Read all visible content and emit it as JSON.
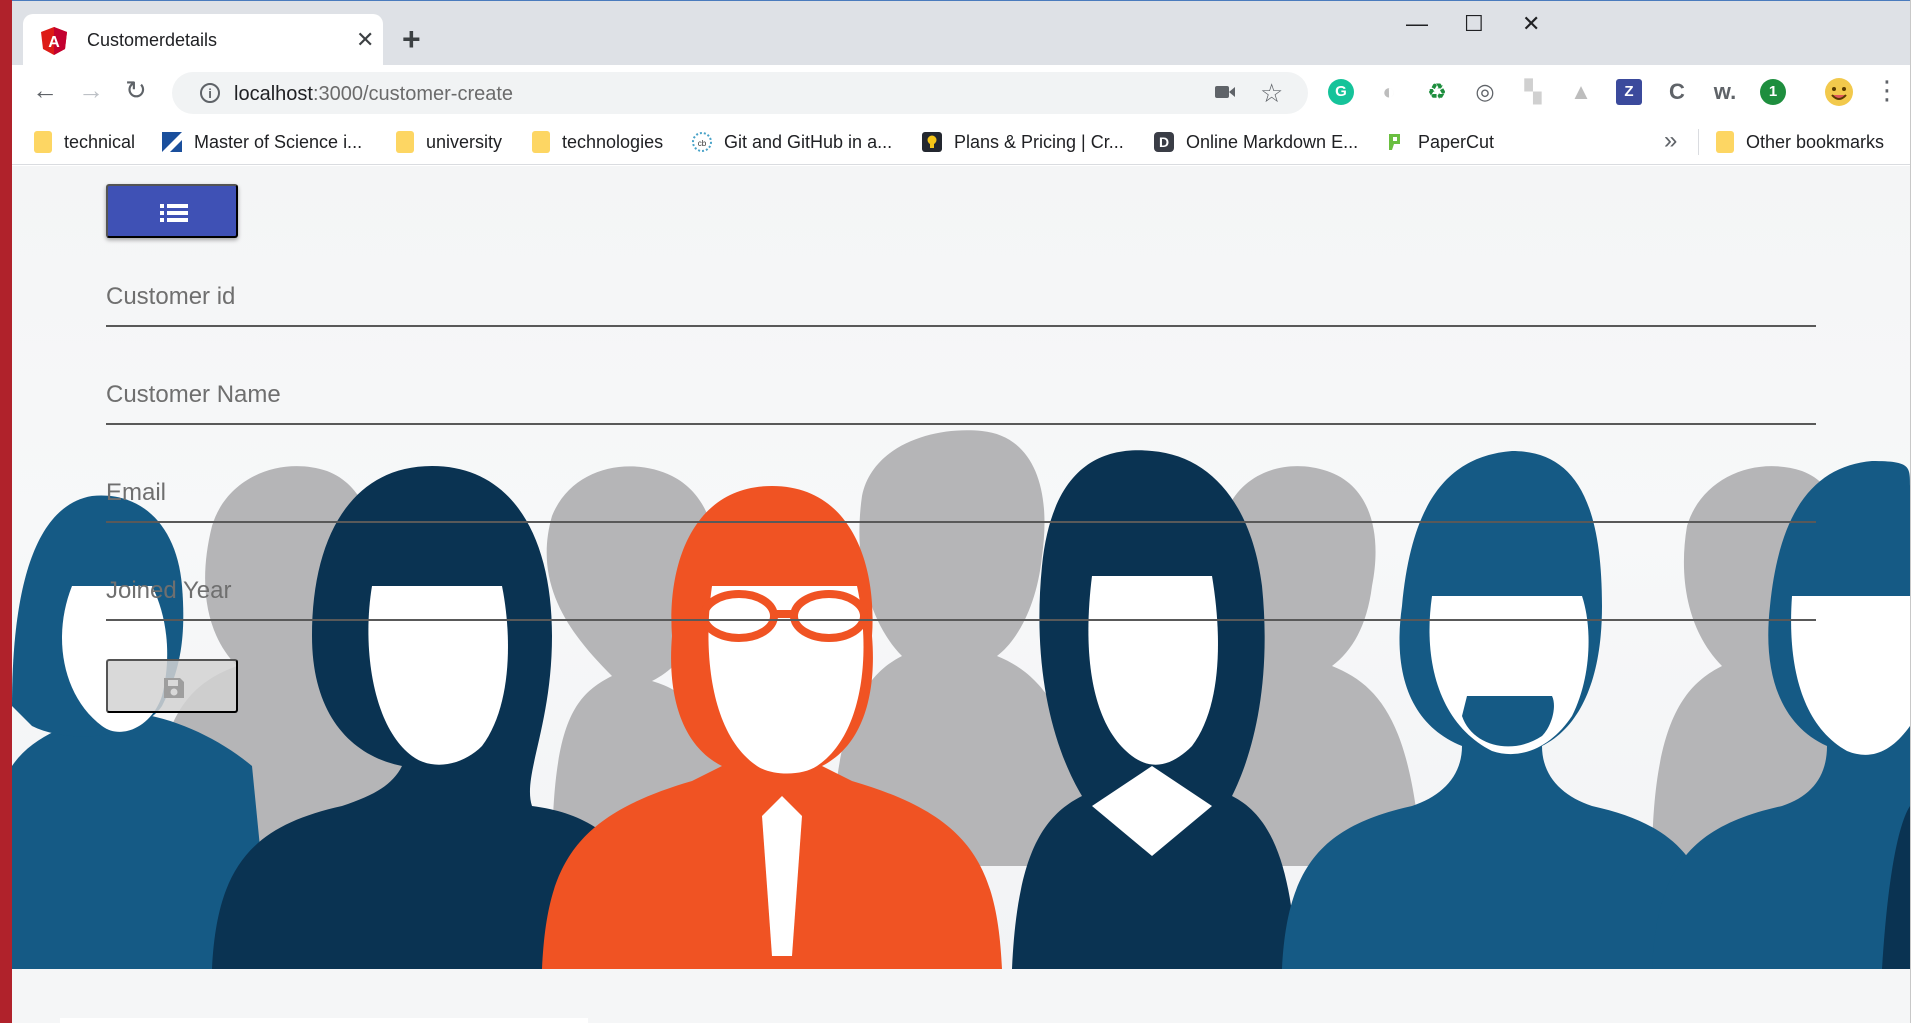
{
  "browser": {
    "tab_title": "Customerdetails",
    "tab_close": "✕",
    "new_tab": "+",
    "window_controls": {
      "minimize": "—",
      "maximize": "☐",
      "close": "✕"
    },
    "nav": {
      "back": "←",
      "forward": "→",
      "reload": "↻"
    },
    "url_host": "localhost",
    "url_path": ":3000/customer-create",
    "extensions": [
      {
        "name": "grammarly-icon",
        "glyph": "G",
        "color": "#15c39a"
      },
      {
        "name": "circle-extension-icon",
        "glyph": "◐",
        "color": "#bdbdbd"
      },
      {
        "name": "recycle-icon",
        "glyph": "♻",
        "color": "#1e8e3e"
      },
      {
        "name": "swirl-extension-icon",
        "glyph": "◎",
        "color": "#5f6368"
      },
      {
        "name": "grey-square-extension-icon",
        "glyph": "▚",
        "color": "#d0d0d0"
      },
      {
        "name": "drive-icon",
        "glyph": "▲",
        "color": "#bdbdbd"
      },
      {
        "name": "z-extension-icon",
        "glyph": "Z",
        "color": "#3b4a9c"
      },
      {
        "name": "c-extension-icon",
        "glyph": "C",
        "color": "#5f6368"
      },
      {
        "name": "w-extension-icon",
        "glyph": "w.",
        "color": "#5f6368"
      },
      {
        "name": "chat-extension-icon",
        "glyph": "1",
        "color": "#1e8e3e"
      }
    ]
  },
  "bookmarks": {
    "items": [
      {
        "label": "technical",
        "icon": "folder-icon"
      },
      {
        "label": "Master of Science i...",
        "icon": "site-icon"
      },
      {
        "label": "university",
        "icon": "folder-icon"
      },
      {
        "label": "technologies",
        "icon": "folder-icon"
      },
      {
        "label": "Git and GitHub in a...",
        "icon": "site-icon"
      },
      {
        "label": "Plans & Pricing | Cr...",
        "icon": "bulb-icon"
      },
      {
        "label": "Online Markdown E...",
        "icon": "d-icon"
      },
      {
        "label": "PaperCut",
        "icon": "papercut-icon"
      }
    ],
    "overflow": "»",
    "other": "Other bookmarks"
  },
  "form": {
    "customer_id_placeholder": "Customer id",
    "customer_name_placeholder": "Customer Name",
    "email_placeholder": "Email",
    "joined_year_placeholder": "Joined Year"
  },
  "colors": {
    "primary_button": "#3f51b5",
    "accent_orange": "#f05323",
    "navy": "#0a3352",
    "blue": "#155a85",
    "grey_people": "#b5b5b7"
  }
}
